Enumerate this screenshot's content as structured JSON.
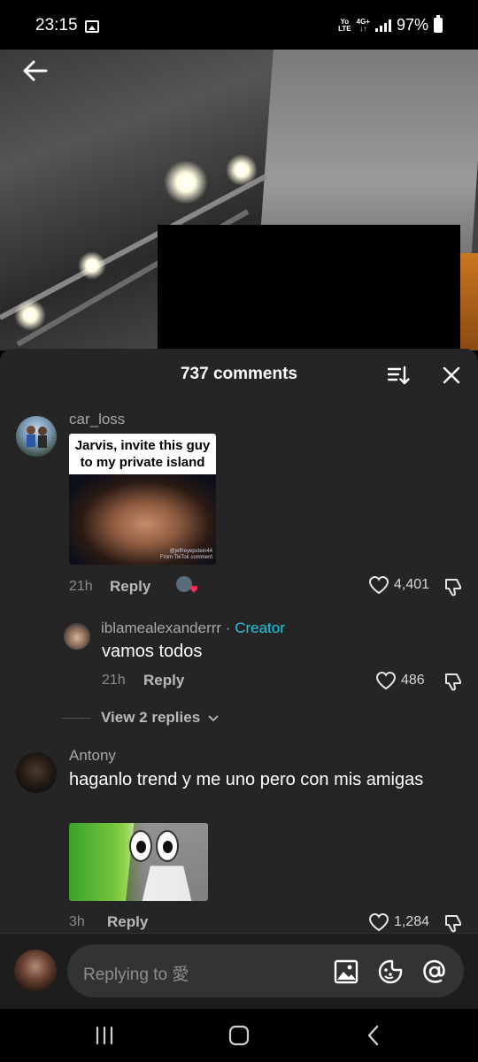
{
  "status_bar": {
    "time": "23:15",
    "network_top": "Yo",
    "network_bottom": "LTE",
    "data_top": "4G+",
    "data_bottom": "↓↑",
    "battery": "97%"
  },
  "video": {
    "watermark_lines": [
      "@jeffreyepstein44",
      "From TikTok comment"
    ]
  },
  "comments_sheet": {
    "title": "737 comments",
    "comments": [
      {
        "username": "car_loss",
        "image_caption": "Jarvis, invite this guy to my private island",
        "time": "21h",
        "reply_label": "Reply",
        "likes": "4,401"
      },
      {
        "username": "iblamealexanderrr",
        "separator": " · ",
        "creator_label": "Creator",
        "text": "vamos todos",
        "time": "21h",
        "reply_label": "Reply",
        "likes": "486"
      },
      {
        "username": "Antony",
        "text": "haganlo trend y me uno pero con mis amigas",
        "time": "3h",
        "reply_label": "Reply",
        "likes": "1,284"
      }
    ],
    "view_replies": "View 2 replies"
  },
  "input_bar": {
    "placeholder": "Replying to 愛"
  },
  "colors": {
    "sheet_bg": "#252525",
    "creator": "#21c6df",
    "like_heart_red": "#fe2c55"
  }
}
